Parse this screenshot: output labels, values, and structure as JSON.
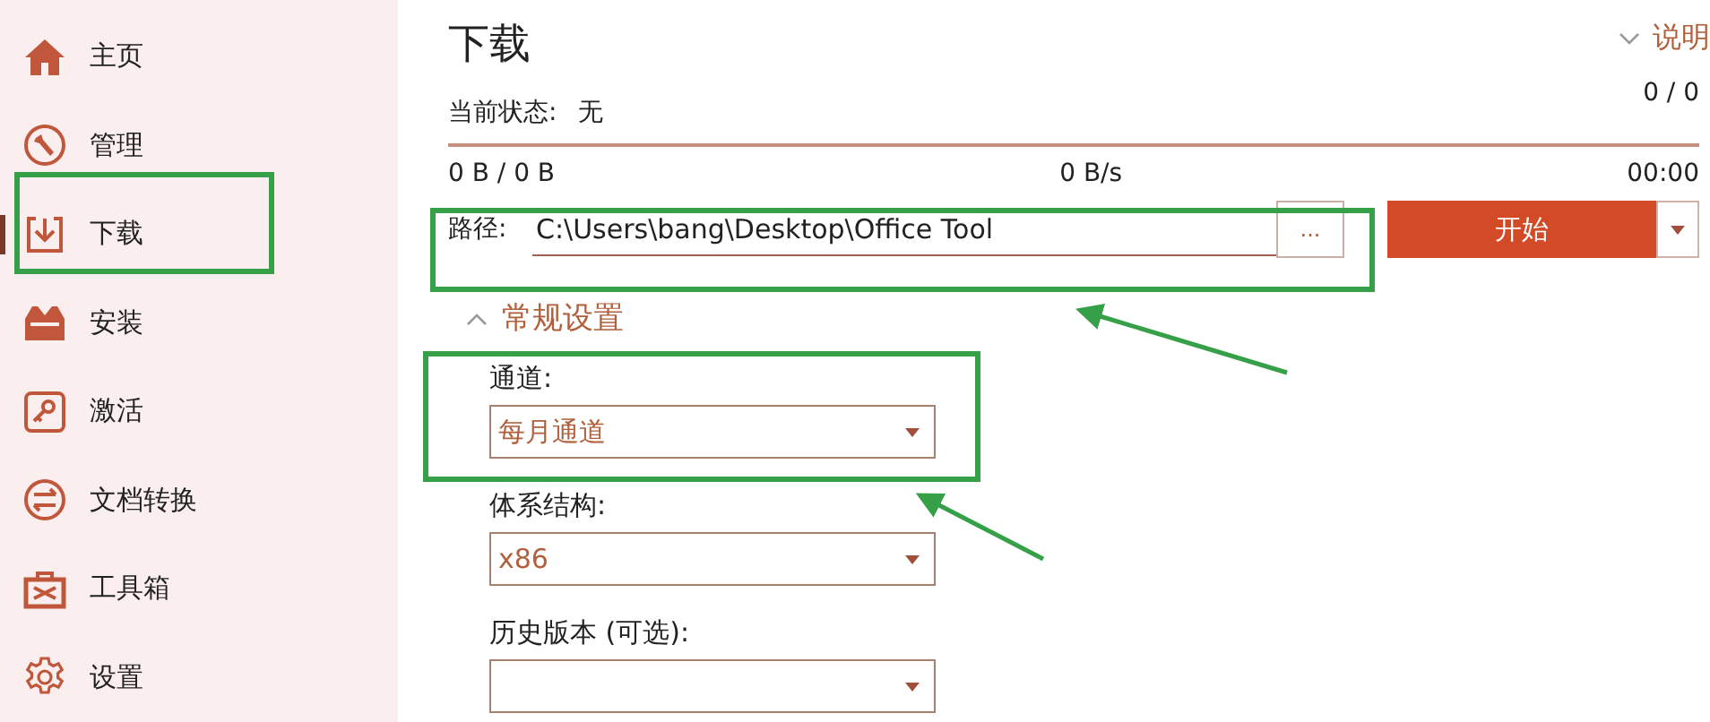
{
  "sidebar": {
    "items": [
      {
        "label": "主页",
        "selected": false
      },
      {
        "label": "管理",
        "selected": false
      },
      {
        "label": "下载",
        "selected": true
      },
      {
        "label": "安装",
        "selected": false
      },
      {
        "label": "激活",
        "selected": false
      },
      {
        "label": "文档转换",
        "selected": false
      },
      {
        "label": "工具箱",
        "selected": false
      },
      {
        "label": "设置",
        "selected": false
      }
    ]
  },
  "title": "下载",
  "help": {
    "label": "说明",
    "expanded": false
  },
  "status": {
    "label": "当前状态:",
    "value": "无",
    "count": "0 / 0",
    "level": 0,
    "size": "0 B / 0 B",
    "speed": "0 B/s",
    "time": "00:00"
  },
  "path": {
    "label": "路径:",
    "value": "C:\\Users\\bang\\Desktop\\Office Tool",
    "browse": "...",
    "start": "开始"
  },
  "section": {
    "title": "常规设置",
    "expanded": true
  },
  "fields": [
    {
      "label": "通道:",
      "value": "每月通道"
    },
    {
      "label": "体系结构:",
      "value": "x86"
    },
    {
      "label": "历史版本 (可选):"
    }
  ]
}
